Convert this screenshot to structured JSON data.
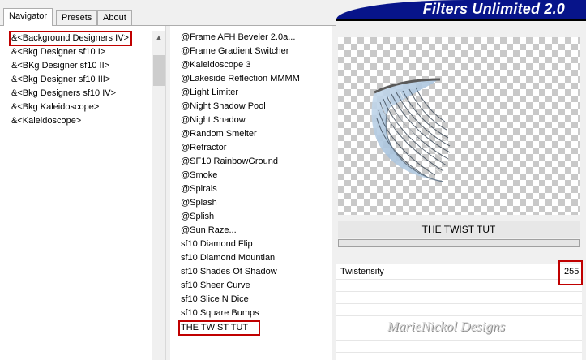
{
  "tabs": [
    {
      "label": "Navigator",
      "active": true
    },
    {
      "label": "Presets",
      "active": false
    },
    {
      "label": "About",
      "active": false
    }
  ],
  "banner": {
    "title": "Filters Unlimited 2.0",
    "color": "#07148a"
  },
  "categories": {
    "items": [
      "&<Background Designers IV>",
      "&<Bkg Designer sf10 I>",
      "&<BKg Designer sf10 II>",
      "&<Bkg Designer sf10 III>",
      "&<Bkg Designers sf10 IV>",
      "&<Bkg Kaleidoscope>",
      "&<Kaleidoscope>"
    ],
    "selected_index": 0
  },
  "filters": {
    "items": [
      "@Frame AFH Beveler 2.0a...",
      "@Frame Gradient Switcher",
      "@Kaleidoscope 3",
      "@Lakeside Reflection MMMM",
      "@Light Limiter",
      "@Night Shadow Pool",
      "@Night Shadow",
      "@Random Smelter",
      "@Refractor",
      "@SF10 RainbowGround",
      "@Smoke",
      "@Spirals",
      "@Splash",
      "@Splish",
      "@Sun Raze...",
      "sf10 Diamond Flip",
      "sf10 Diamond Mountian",
      "sf10 Shades Of Shadow",
      "sf10 Sheer Curve",
      "sf10 Slice N Dice",
      "sf10 Square Bumps",
      "THE TWIST TUT"
    ],
    "selected_index": 21
  },
  "preview": {
    "filter_name": "THE TWIST TUT"
  },
  "params": [
    {
      "label": "Twistensity",
      "value": "255"
    }
  ],
  "watermark": "MarieNickol Designs",
  "colors": {
    "highlight_box": "#c00000",
    "banner": "#07148a"
  }
}
